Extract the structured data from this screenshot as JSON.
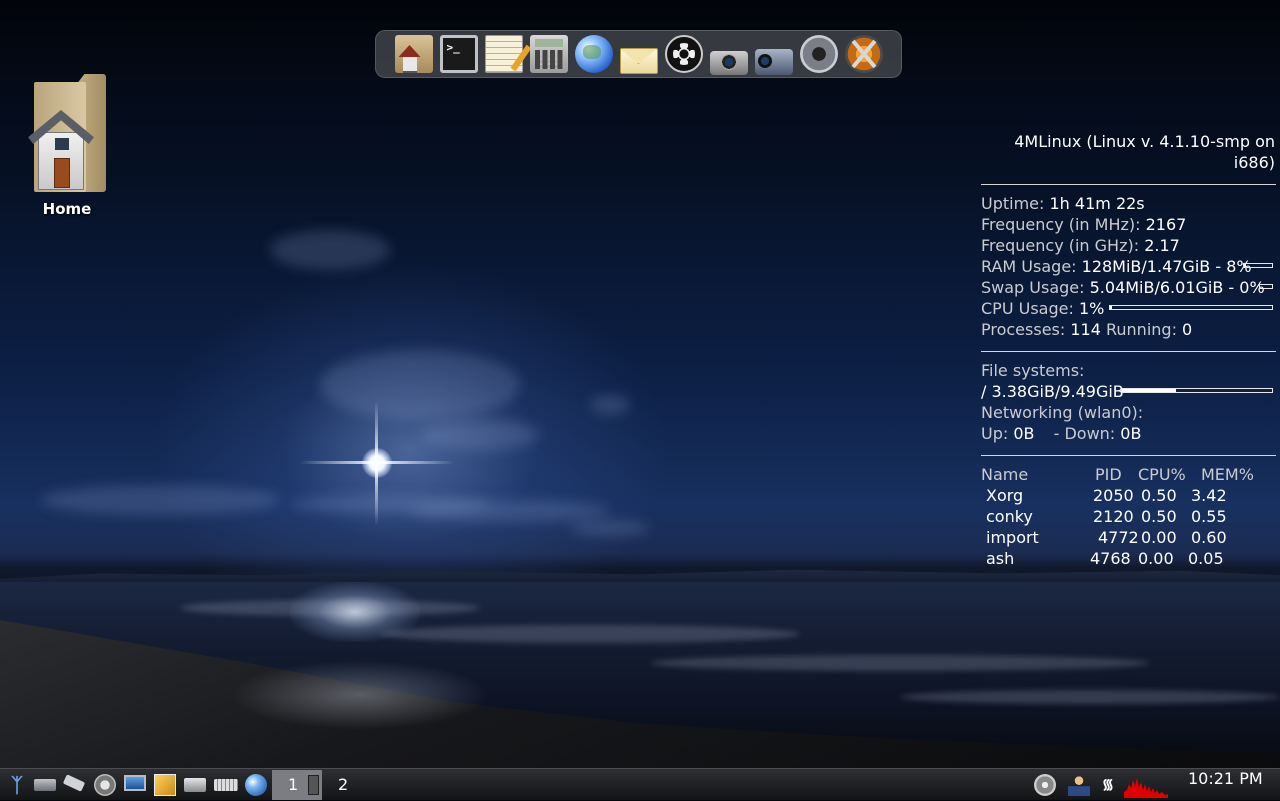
{
  "desktop": {
    "icons": [
      {
        "label": "Home",
        "icon": "home-folder-icon"
      }
    ]
  },
  "dock": {
    "items": [
      {
        "name": "home-folder",
        "icon": "home-folder-icon"
      },
      {
        "name": "terminal",
        "icon": "terminal-icon"
      },
      {
        "name": "text-editor",
        "icon": "notepad-icon"
      },
      {
        "name": "calculator",
        "icon": "calculator-icon"
      },
      {
        "name": "web-browser",
        "icon": "globe-icon"
      },
      {
        "name": "mail",
        "icon": "envelope-icon"
      },
      {
        "name": "media-player",
        "icon": "film-reel-icon"
      },
      {
        "name": "screenshot",
        "icon": "camera-icon"
      },
      {
        "name": "video-capture",
        "icon": "camcorder-icon"
      },
      {
        "name": "webcam",
        "icon": "webcam-icon"
      },
      {
        "name": "logout",
        "icon": "xfce-logo-icon"
      }
    ]
  },
  "conky": {
    "header": "4MLinux (Linux v. 4.1.10-smp on i686)",
    "uptime_label": "Uptime:",
    "uptime": "1h 41m 22s",
    "freq_mhz_label": "Frequency (in MHz):",
    "freq_mhz": "2167",
    "freq_ghz_label": "Frequency (in GHz):",
    "freq_ghz": "2.17",
    "ram_label": "RAM Usage:",
    "ram": "128MiB/1.47GiB - 8%",
    "ram_fraction": 0.08,
    "swap_label": "Swap Usage:",
    "swap": "5.04MiB/6.01GiB - 0%",
    "swap_fraction": 0.0,
    "cpu_label": "CPU Usage:",
    "cpu": "1%",
    "cpu_fraction": 0.01,
    "processes_label": "Processes:",
    "processes": "114",
    "running_label": "Running:",
    "running": "0",
    "fs_label": "File systems:",
    "fs_root": " / 3.38GiB/9.49GiB",
    "fs_fraction": 0.36,
    "net_label": "Networking (wlan0):",
    "up_label": "Up:",
    "up": "0B",
    "down_label": "- Down:",
    "down": "0B",
    "proc_headers": {
      "name": "Name",
      "pid": "PID",
      "cpu": "CPU%",
      "mem": "MEM%"
    },
    "procs": [
      {
        "name": "Xorg",
        "pid": "2050",
        "cpu": "0.50",
        "mem": "3.42"
      },
      {
        "name": "conky",
        "pid": "2120",
        "cpu": "0.50",
        "mem": "0.55"
      },
      {
        "name": "import",
        "pid": "4772",
        "cpu": "0.00",
        "mem": "0.60"
      },
      {
        "name": "ash",
        "pid": "4768",
        "cpu": "0.00",
        "mem": "0.05"
      }
    ]
  },
  "taskbar": {
    "launchers": [
      {
        "name": "start-menu",
        "icon": "4mlinux-logo-icon"
      },
      {
        "name": "drive",
        "icon": "hard-drive-icon"
      },
      {
        "name": "usb",
        "icon": "usb-stick-icon"
      },
      {
        "name": "speaker",
        "icon": "speaker-icon"
      },
      {
        "name": "display",
        "icon": "monitor-icon"
      },
      {
        "name": "image-viewer",
        "icon": "picture-icon"
      },
      {
        "name": "printer",
        "icon": "printer-icon"
      },
      {
        "name": "keyboard",
        "icon": "keyboard-icon"
      },
      {
        "name": "browser",
        "icon": "globe-icon"
      }
    ],
    "workspaces": [
      "1",
      "2"
    ],
    "active_workspace": "1",
    "tray": [
      "volume-icon",
      "user-icon",
      "wifi-icon",
      "cpu-graph-icon"
    ],
    "clock": "10:21 PM"
  },
  "colors": {
    "taskbar_bg": "#1c1d20",
    "workspace_active": "#7b7d82",
    "cpu_graph": "#e00000",
    "dock_bg": "#46484e"
  }
}
